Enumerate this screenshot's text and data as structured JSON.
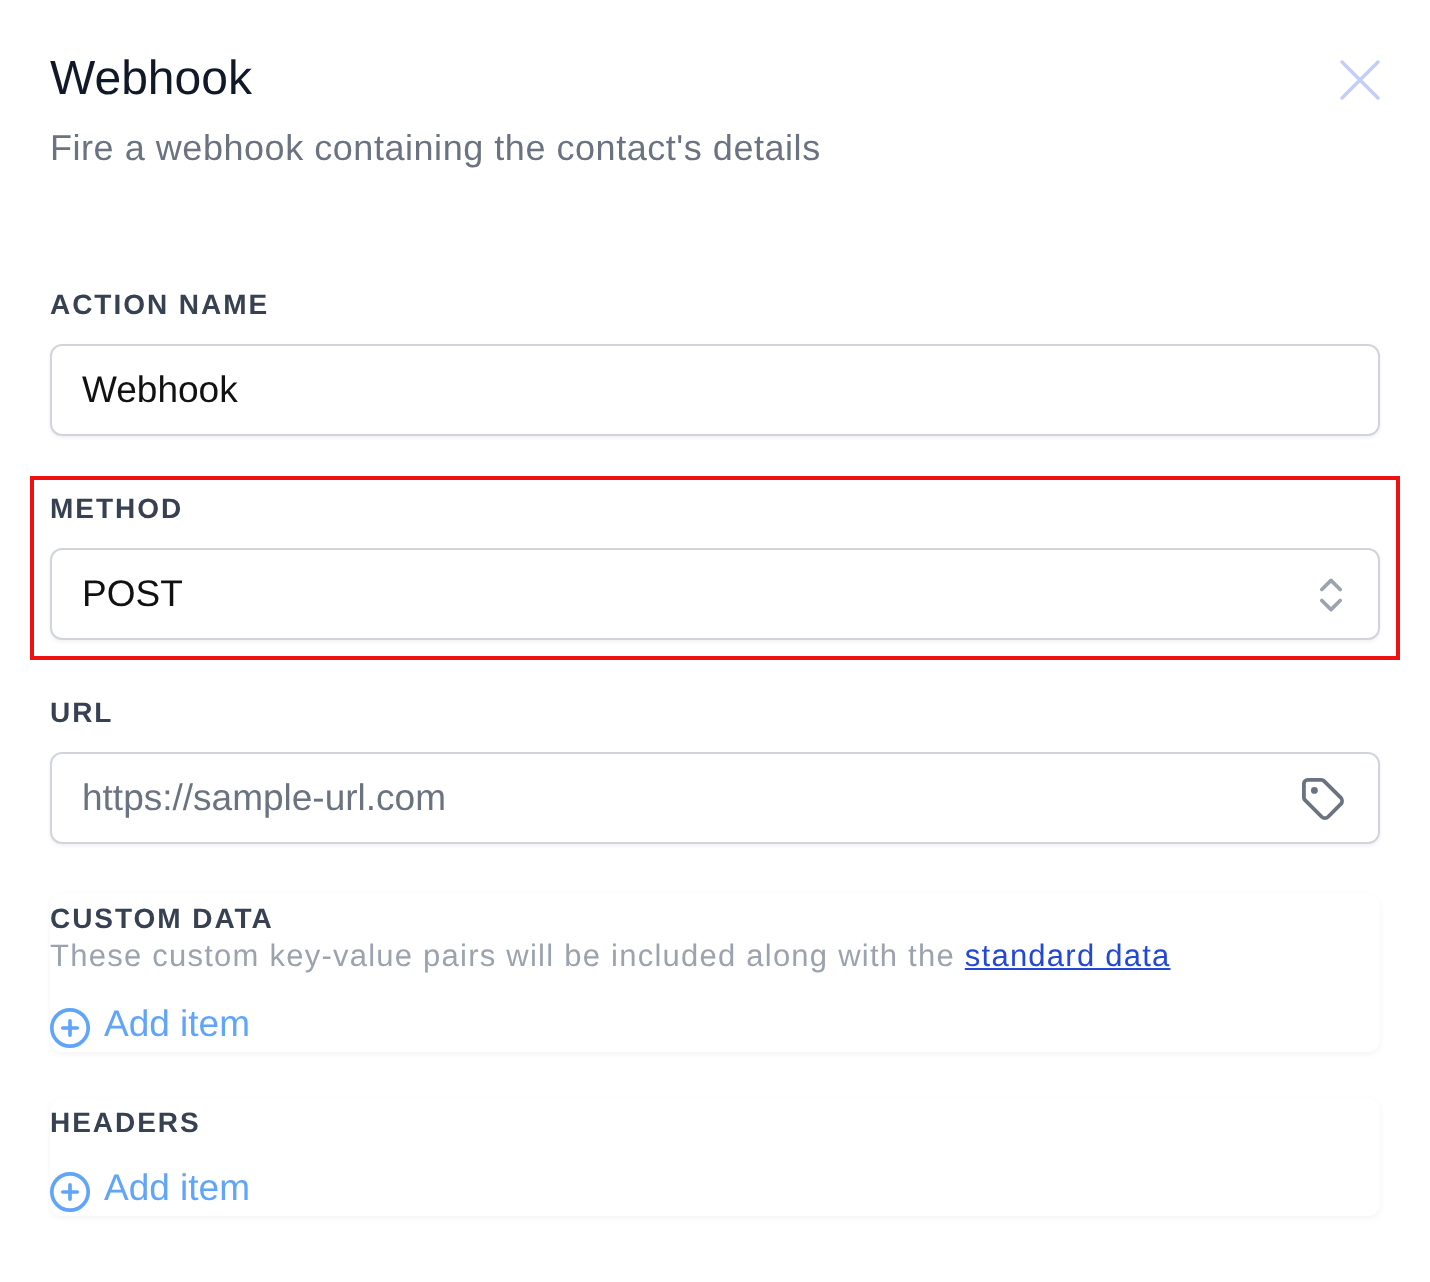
{
  "dialog": {
    "title": "Webhook",
    "subtitle": "Fire a webhook containing the contact's details"
  },
  "fields": [
    {
      "kind": "input",
      "label": "ACTION NAME",
      "value": "Webhook",
      "highlighted": false
    },
    {
      "kind": "select",
      "label": "METHOD",
      "value": "POST",
      "highlighted": true
    },
    {
      "kind": "tag-input",
      "label": "URL",
      "placeholder": "https://sample-url.com",
      "highlighted": false
    }
  ],
  "lists": [
    {
      "label": "CUSTOM DATA",
      "description": "These custom key-value pairs will be included along with the",
      "link": "standard data",
      "add_button": "Add item"
    },
    {
      "label": "HEADERS",
      "add_button": "Add item"
    }
  ]
}
